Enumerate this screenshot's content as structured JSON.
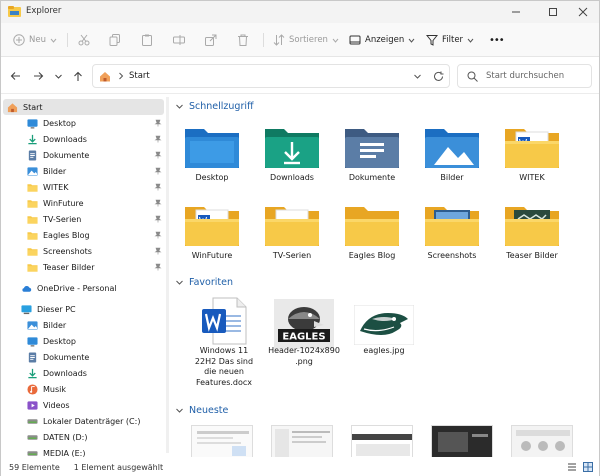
{
  "window": {
    "title": "Explorer"
  },
  "toolbar": {
    "new_label": "Neu",
    "sort_label": "Sortieren",
    "view_label": "Anzeigen",
    "filter_label": "Filter",
    "more_label": "•••"
  },
  "address": {
    "crumb": "Start",
    "search_placeholder": "Start durchsuchen"
  },
  "sidebar": {
    "items": [
      {
        "label": "Start",
        "icon": "home-icon"
      },
      {
        "label": "Desktop",
        "icon": "desktop-icon"
      },
      {
        "label": "Downloads",
        "icon": "download-icon"
      },
      {
        "label": "Dokumente",
        "icon": "document-icon"
      },
      {
        "label": "Bilder",
        "icon": "pictures-icon"
      },
      {
        "label": "WITEK",
        "icon": "folder-icon"
      },
      {
        "label": "WinFuture",
        "icon": "folder-icon"
      },
      {
        "label": "TV-Serien",
        "icon": "folder-icon"
      },
      {
        "label": "Eagles Blog",
        "icon": "folder-icon"
      },
      {
        "label": "Screenshots",
        "icon": "folder-icon"
      },
      {
        "label": "Teaser Bilder",
        "icon": "folder-icon"
      },
      {
        "label": "OneDrive - Personal",
        "icon": "cloud-icon"
      },
      {
        "label": "Dieser PC",
        "icon": "pc-icon"
      },
      {
        "label": "Bilder",
        "icon": "pictures-icon"
      },
      {
        "label": "Desktop",
        "icon": "desktop-icon"
      },
      {
        "label": "Dokumente",
        "icon": "document-icon"
      },
      {
        "label": "Downloads",
        "icon": "download-icon"
      },
      {
        "label": "Musik",
        "icon": "music-icon"
      },
      {
        "label": "Videos",
        "icon": "video-icon"
      },
      {
        "label": "Lokaler Datenträger (C:)",
        "icon": "drive-icon"
      },
      {
        "label": "DATEN (D:)",
        "icon": "drive-icon"
      },
      {
        "label": "MEDIA (E:)",
        "icon": "drive-icon"
      }
    ]
  },
  "main": {
    "quick_access_title": "Schnellzugriff",
    "favorites_title": "Favoriten",
    "recent_title": "Neueste",
    "quick_access": [
      {
        "label": "Desktop"
      },
      {
        "label": "Downloads"
      },
      {
        "label": "Dokumente"
      },
      {
        "label": "Bilder"
      },
      {
        "label": "WITEK"
      },
      {
        "label": "WinFuture"
      },
      {
        "label": "TV-Serien"
      },
      {
        "label": "Eagles Blog"
      },
      {
        "label": "Screenshots"
      },
      {
        "label": "Teaser Bilder"
      }
    ],
    "favorites": [
      {
        "line1": "Windows 11",
        "line2": "22H2 Das sind",
        "line3": "die neuen",
        "line4": "Features.docx"
      },
      {
        "line1": "Header-1024x890",
        "line2": ".png",
        "line3": "",
        "line4": ""
      },
      {
        "line1": "eagles.jpg",
        "line2": "",
        "line3": "",
        "line4": ""
      }
    ],
    "favorites_logo_text": "EAGLES"
  },
  "status": {
    "count": "59 Elemente",
    "selection": "1 Element ausgewählt"
  },
  "colors": {
    "accent": "#1f5fa8",
    "folder": "#f7c948",
    "folder_dark": "#e8a623"
  }
}
